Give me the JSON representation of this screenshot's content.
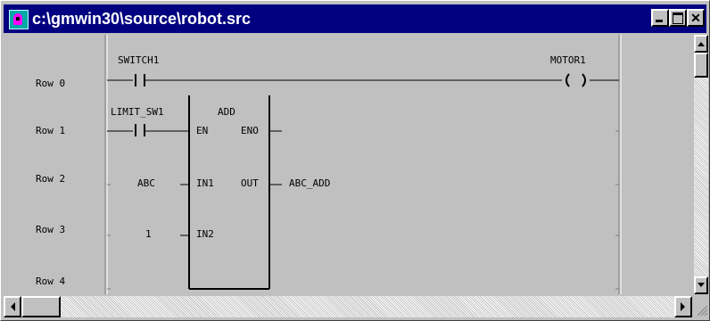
{
  "window": {
    "title": "c:\\gmwin30\\source\\robot.src",
    "title_bar_color": "#000080",
    "icons": {
      "app": "ladder-app-icon",
      "minimize": "minimize-icon",
      "maximize": "maximize-icon",
      "close": "close-icon"
    }
  },
  "ladder": {
    "rows": [
      "Row 0",
      "Row 1",
      "Row 2",
      "Row 3",
      "Row 4"
    ],
    "contacts": [
      {
        "label": "SWITCH1"
      },
      {
        "label": "LIMIT_SW1"
      }
    ],
    "coil": {
      "label": "MOTOR1"
    },
    "function_block": {
      "name": "ADD",
      "inputs": [
        "EN",
        "IN1",
        "IN2"
      ],
      "outputs": [
        "ENO",
        "OUT"
      ]
    },
    "operands": {
      "in1": "ABC",
      "in2": "1",
      "out": "ABC_ADD"
    }
  },
  "scrollbars": {
    "vertical": true,
    "horizontal": true
  }
}
